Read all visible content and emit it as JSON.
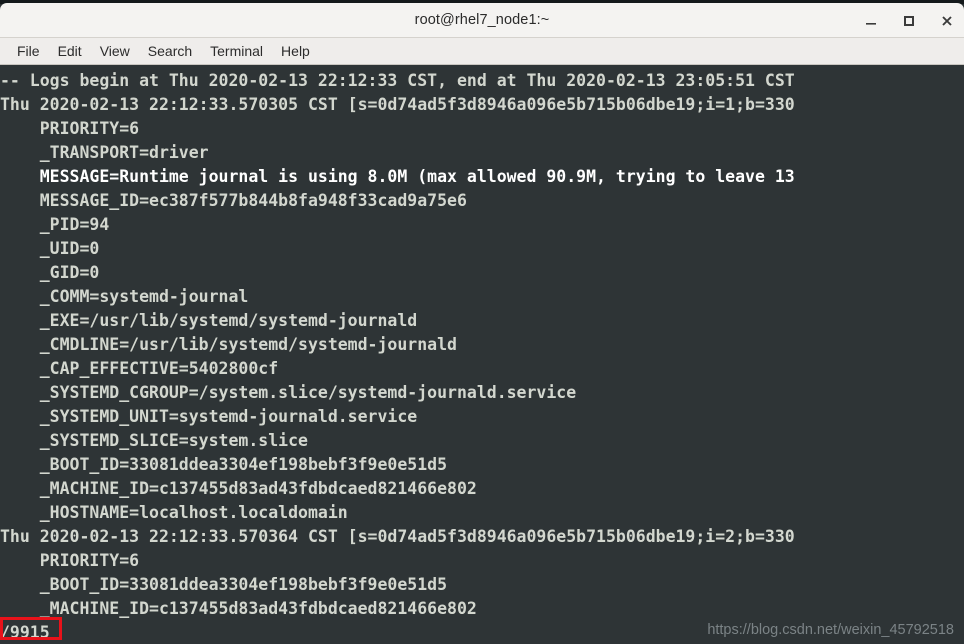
{
  "window": {
    "title": "root@rhel7_node1:~",
    "controls": [
      {
        "name": "minimize-button",
        "glyph": "minimize-icon"
      },
      {
        "name": "maximize-button",
        "glyph": "maximize-icon"
      },
      {
        "name": "close-button",
        "glyph": "close-icon"
      }
    ]
  },
  "menubar": {
    "items": [
      {
        "label": "File"
      },
      {
        "label": "Edit"
      },
      {
        "label": "View"
      },
      {
        "label": "Search"
      },
      {
        "label": "Terminal"
      },
      {
        "label": "Help"
      }
    ]
  },
  "terminal": {
    "background_color": "#2e3436",
    "text_color": "#d3d7cf",
    "bright_text_color": "#ffffff",
    "lines": [
      {
        "text": "-- Logs begin at Thu 2020-02-13 22:12:33 CST, end at Thu 2020-02-13 23:05:51 CST",
        "bright": false
      },
      {
        "text": "Thu 2020-02-13 22:12:33.570305 CST [s=0d74ad5f3d8946a096e5b715b06dbe19;i=1;b=330",
        "bright": false
      },
      {
        "text": "    PRIORITY=6",
        "bright": false
      },
      {
        "text": "    _TRANSPORT=driver",
        "bright": false
      },
      {
        "text": "    MESSAGE=Runtime journal is using 8.0M (max allowed 90.9M, trying to leave 13",
        "bright": true
      },
      {
        "text": "    MESSAGE_ID=ec387f577b844b8fa948f33cad9a75e6",
        "bright": false
      },
      {
        "text": "    _PID=94",
        "bright": false
      },
      {
        "text": "    _UID=0",
        "bright": false
      },
      {
        "text": "    _GID=0",
        "bright": false
      },
      {
        "text": "    _COMM=systemd-journal",
        "bright": false
      },
      {
        "text": "    _EXE=/usr/lib/systemd/systemd-journald",
        "bright": false
      },
      {
        "text": "    _CMDLINE=/usr/lib/systemd/systemd-journald",
        "bright": false
      },
      {
        "text": "    _CAP_EFFECTIVE=5402800cf",
        "bright": false
      },
      {
        "text": "    _SYSTEMD_CGROUP=/system.slice/systemd-journald.service",
        "bright": false
      },
      {
        "text": "    _SYSTEMD_UNIT=systemd-journald.service",
        "bright": false
      },
      {
        "text": "    _SYSTEMD_SLICE=system.slice",
        "bright": false
      },
      {
        "text": "    _BOOT_ID=33081ddea3304ef198bebf3f9e0e51d5",
        "bright": false
      },
      {
        "text": "    _MACHINE_ID=c137455d83ad43fdbdcaed821466e802",
        "bright": false
      },
      {
        "text": "    _HOSTNAME=localhost.localdomain",
        "bright": false
      },
      {
        "text": "Thu 2020-02-13 22:12:33.570364 CST [s=0d74ad5f3d8946a096e5b715b06dbe19;i=2;b=330",
        "bright": false
      },
      {
        "text": "    PRIORITY=6",
        "bright": false
      },
      {
        "text": "    _BOOT_ID=33081ddea3304ef198bebf3f9e0e51d5",
        "bright": false
      },
      {
        "text": "    _MACHINE_ID=c137455d83ad43fdbdcaed821466e802",
        "bright": false
      },
      {
        "text": "/9915",
        "bright": false
      }
    ]
  },
  "annotation": {
    "box_color": "#e8121a",
    "highlighted_text": "/9915"
  },
  "watermark": {
    "text": "https://blog.csdn.net/weixin_45792518",
    "color": "#7b8386"
  }
}
